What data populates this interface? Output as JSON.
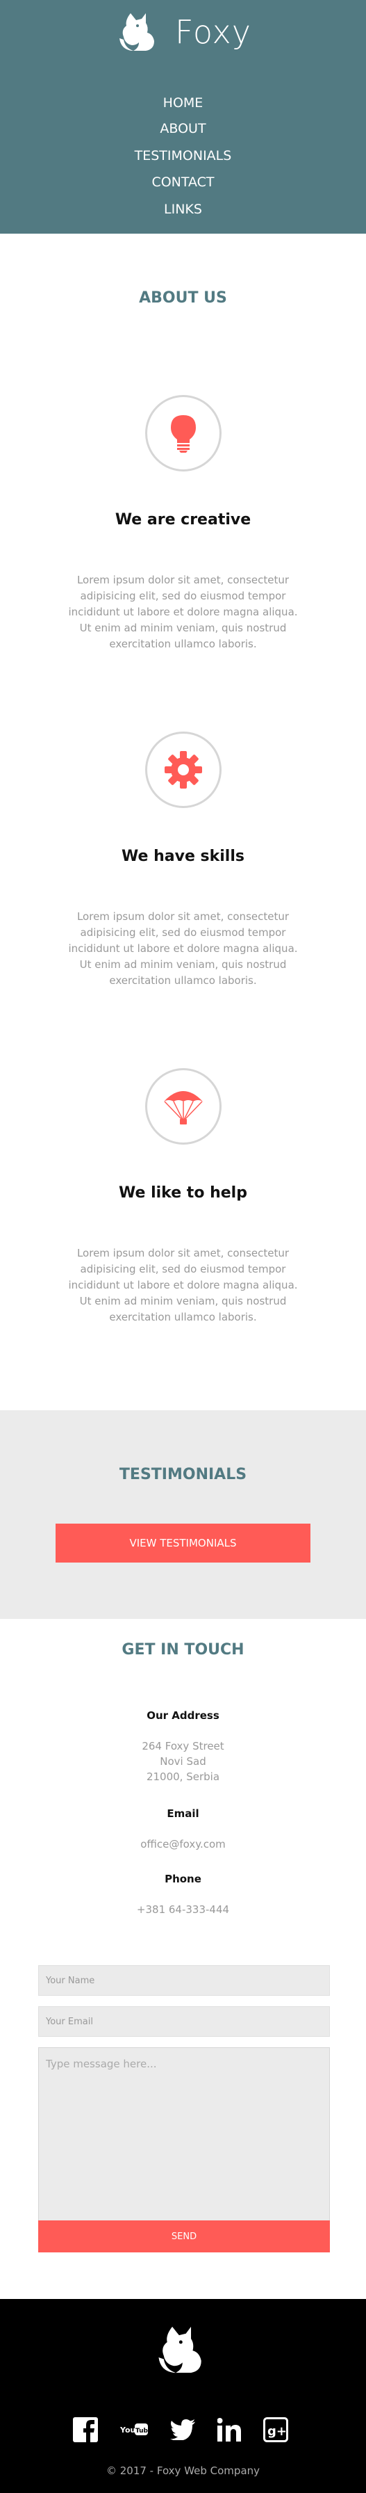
{
  "brand": {
    "name": "Foxy"
  },
  "nav": {
    "items": [
      "HOME",
      "ABOUT",
      "TESTIMONIALS",
      "CONTACT",
      "LINKS"
    ]
  },
  "about": {
    "title": "ABOUT US",
    "features": [
      {
        "icon": "lightbulb-icon",
        "title": "We are creative",
        "text": "Lorem ipsum dolor sit amet, consectetur adipisicing elit, sed do eiusmod tempor incididunt ut labore et dolore magna aliqua. Ut enim ad minim veniam, quis nostrud exercitation ullamco laboris."
      },
      {
        "icon": "gear-icon",
        "title": "We have skills",
        "text": "Lorem ipsum dolor sit amet, consectetur adipisicing elit, sed do eiusmod tempor incididunt ut labore et dolore magna aliqua. Ut enim ad minim veniam, quis nostrud exercitation ullamco laboris."
      },
      {
        "icon": "parachute-icon",
        "title": "We like to help",
        "text": "Lorem ipsum dolor sit amet, consectetur adipisicing elit, sed do eiusmod tempor incididunt ut labore et dolore magna aliqua. Ut enim ad minim veniam, quis nostrud exercitation ullamco laboris."
      }
    ]
  },
  "testimonials": {
    "title": "TESTIMONIALS",
    "button_label": "VIEW TESTIMONIALS"
  },
  "contact": {
    "title": "GET IN TOUCH",
    "address_label": "Our Address",
    "address_lines": [
      "264 Foxy Street",
      "Novi Sad",
      "21000, Serbia"
    ],
    "email_label": "Email",
    "email": "office@foxy.com",
    "phone_label": "Phone",
    "phone": "+381 64-333-444",
    "form": {
      "name_placeholder": "Your Name",
      "email_placeholder": "Your Email",
      "message_placeholder": "Type message here...",
      "send_label": "SEND"
    }
  },
  "footer": {
    "social_icons": [
      "facebook-icon",
      "youtube-icon",
      "twitter-icon",
      "linkedin-icon",
      "google-plus-icon"
    ],
    "youtube_text": "YouTube",
    "linkedin_text": "in",
    "googleplus_text": "g+",
    "copyright": "© 2017 - Foxy Web Company"
  },
  "colors": {
    "header_bg": "#527a82",
    "accent": "#ff5b56",
    "title": "#527a82",
    "testimonials_bg": "#ebebeb",
    "footer_bg": "#000000"
  }
}
